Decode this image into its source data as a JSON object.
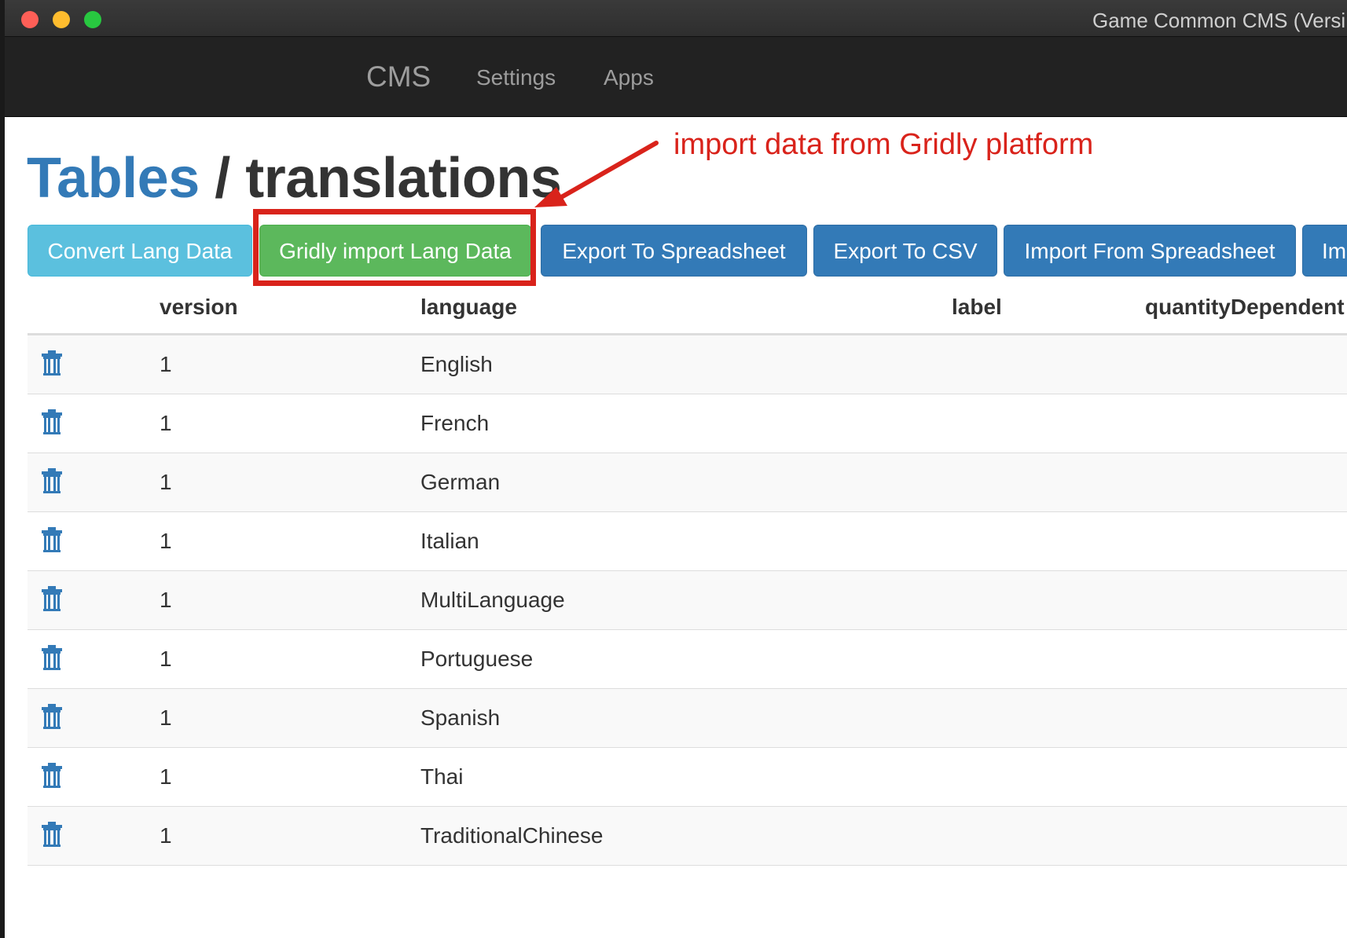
{
  "window": {
    "title": "Game Common CMS (Versi"
  },
  "navbar": {
    "brand": "CMS",
    "links": [
      "Settings",
      "Apps"
    ]
  },
  "page": {
    "breadcrumb_link": "Tables",
    "breadcrumb_separator": "/",
    "breadcrumb_current": "translations"
  },
  "annotation": {
    "text": "import data from Gridly platform",
    "color": "#d9231b"
  },
  "toolbar": {
    "convert_label": "Convert Lang Data",
    "gridly_label": "Gridly import Lang Data",
    "export_spreadsheet_label": "Export To Spreadsheet",
    "export_csv_label": "Export To CSV",
    "import_spreadsheet_label": "Import From Spreadsheet",
    "import_more_label": "Im"
  },
  "table": {
    "headers": [
      "version",
      "language",
      "label",
      "quantityDependent"
    ],
    "rows": [
      {
        "version": "1",
        "language": "English"
      },
      {
        "version": "1",
        "language": "French"
      },
      {
        "version": "1",
        "language": "German"
      },
      {
        "version": "1",
        "language": "Italian"
      },
      {
        "version": "1",
        "language": "MultiLanguage"
      },
      {
        "version": "1",
        "language": "Portuguese"
      },
      {
        "version": "1",
        "language": "Spanish"
      },
      {
        "version": "1",
        "language": "Thai"
      },
      {
        "version": "1",
        "language": "TraditionalChinese"
      }
    ],
    "row_action_icon": "trash-icon"
  },
  "colors": {
    "navbar": "#222222",
    "link_blue": "#337ab7",
    "btn_info": "#5bc0de",
    "btn_success": "#5cb85c",
    "btn_primary": "#337ab7",
    "annotation_red": "#d9231b"
  }
}
